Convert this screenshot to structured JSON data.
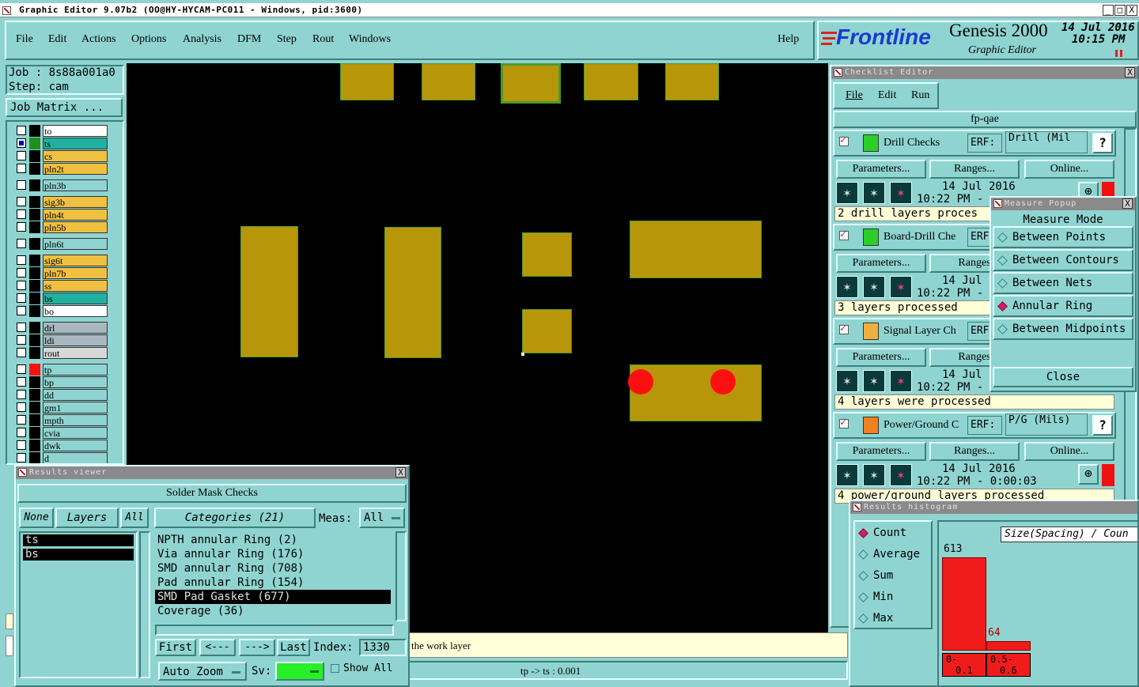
{
  "window": {
    "title": "Graphic Editor 9.07b2  (OO@HY-HYCAM-PC011 - Windows, pid:3600)",
    "controls": [
      "_",
      "□",
      "X"
    ]
  },
  "menu": {
    "items": [
      "File",
      "Edit",
      "Actions",
      "Options",
      "Analysis",
      "DFM",
      "Step",
      "Rout",
      "Windows"
    ],
    "help": "Help"
  },
  "branding": {
    "logo": "Frontline",
    "product": "Genesis 2000",
    "subtitle": "Graphic Editor",
    "date": "14 Jul 2016",
    "time": "10:15 PM"
  },
  "job": {
    "job_label": "Job : 8s88a001a0",
    "step_label": "Step: cam",
    "matrix_button": "Job Matrix ..."
  },
  "layers": [
    {
      "name": "to",
      "color": "#000000",
      "bg": "#ffffff",
      "checked": false
    },
    {
      "name": "ts",
      "color": "#1f8f1f",
      "bg": "#20b0a0",
      "checked": true
    },
    {
      "name": "cs",
      "color": "#000000",
      "bg": "#f0c040",
      "checked": false
    },
    {
      "name": "pln2t",
      "color": "#000000",
      "bg": "#f0c040",
      "checked": false
    },
    {
      "name": "pln3b",
      "color": "#000000",
      "bg": "#8fd4d0",
      "checked": false
    },
    {
      "name": "sig3b",
      "color": "#000000",
      "bg": "#f0c040",
      "checked": false
    },
    {
      "name": "pln4t",
      "color": "#000000",
      "bg": "#f0c040",
      "checked": false
    },
    {
      "name": "pln5b",
      "color": "#000000",
      "bg": "#f0c040",
      "checked": false
    },
    {
      "name": "pln6t",
      "color": "#000000",
      "bg": "#8fd4d0",
      "checked": false
    },
    {
      "name": "sig6t",
      "color": "#000000",
      "bg": "#f0c040",
      "checked": false
    },
    {
      "name": "pln7b",
      "color": "#000000",
      "bg": "#f0c040",
      "checked": false
    },
    {
      "name": "ss",
      "color": "#000000",
      "bg": "#f0c040",
      "checked": false
    },
    {
      "name": "bs",
      "color": "#000000",
      "bg": "#20b0a0",
      "checked": false
    },
    {
      "name": "bo",
      "color": "#000000",
      "bg": "#ffffff",
      "checked": false
    },
    {
      "name": "drl",
      "color": "#000000",
      "bg": "#a8b8c0",
      "checked": false
    },
    {
      "name": "ldi",
      "color": "#000000",
      "bg": "#a8b8c0",
      "checked": false
    },
    {
      "name": "rout",
      "color": "#000000",
      "bg": "#d8d8d8",
      "checked": false
    },
    {
      "name": "tp",
      "color": "#ff1010",
      "bg": "#8fd4d0",
      "checked": false
    },
    {
      "name": "bp",
      "color": "#000000",
      "bg": "#8fd4d0",
      "checked": false
    },
    {
      "name": "dd",
      "color": "#000000",
      "bg": "#8fd4d0",
      "checked": false
    },
    {
      "name": "gm1",
      "color": "#000000",
      "bg": "#8fd4d0",
      "checked": false
    },
    {
      "name": "mpth",
      "color": "#000000",
      "bg": "#8fd4d0",
      "checked": false
    },
    {
      "name": "cvia",
      "color": "#000000",
      "bg": "#8fd4d0",
      "checked": false
    },
    {
      "name": "dwk",
      "color": "#000000",
      "bg": "#8fd4d0",
      "checked": false
    },
    {
      "name": "d",
      "color": "#000000",
      "bg": "#8fd4d0",
      "checked": false
    }
  ],
  "status": {
    "message": "the work layer",
    "measure": "tp -> ts : 0.001"
  },
  "results_viewer": {
    "title": "Results viewer",
    "heading": "Solder Mask Checks",
    "btn_none": "None",
    "btn_layers": "Layers",
    "btn_all": "All",
    "btn_categories": "Categories (21)",
    "meas_label": "Meas:",
    "meas_value": "All",
    "layers": [
      "ts",
      "bs"
    ],
    "categories": [
      "NPTH annular Ring (2)",
      "Via annular Ring (176)",
      "SMD annular Ring (708)",
      "Pad annular Ring (154)",
      "SMD Pad Gasket (677)",
      "Coverage (36)"
    ],
    "selected_index": 4,
    "first": "First",
    "prev": "<---",
    "next": "--->",
    "last": "Last",
    "index_label": "Index:",
    "index_value": "1330",
    "auto_zoom": "Auto Zoom",
    "sv_label": "Sv:",
    "show_all": "Show All"
  },
  "checklist": {
    "title": "Checklist Editor",
    "menu": [
      "File",
      "Edit",
      "Run"
    ],
    "name": "fp-qae",
    "checks": [
      {
        "name": "Drill Checks",
        "erf": "ERF:",
        "erf_value": "Drill (Mil",
        "params": "Parameters...",
        "ranges": "Ranges...",
        "online": "Online...",
        "date": "14 Jul 2016",
        "time": "10:22 PM -",
        "result": "2 drill layers proces"
      },
      {
        "name": "Board-Drill Che",
        "erf": "ERF",
        "erf_value": "",
        "params": "Parameters...",
        "ranges": "Ranges",
        "online": "",
        "date": "14 Jul",
        "time": "10:22 PM -",
        "result": "3 layers processed"
      },
      {
        "name": "Signal Layer Ch",
        "erf": "ERF",
        "erf_value": "",
        "params": "Parameters...",
        "ranges": "Ranges",
        "online": "",
        "date": "14 Jul",
        "time": "10:22 PM -",
        "result": "4 layers were processed"
      },
      {
        "name": "Power/Ground C",
        "erf": "ERF:",
        "erf_value": "P/G (Mils)",
        "params": "Parameters...",
        "ranges": "Ranges...",
        "online": "Online...",
        "date": "14 Jul 2016",
        "time": "10:22 PM - 0:00:03",
        "result": "4 power/ground layers processed"
      }
    ]
  },
  "measure_popup": {
    "title": "Measure Popup",
    "mode_label": "Measure Mode",
    "options": [
      "Between Points",
      "Between Contours",
      "Between Nets",
      "Annular Ring",
      "Between Midpoints"
    ],
    "selected": 3,
    "close": "Close"
  },
  "histogram": {
    "title": "Results histogram",
    "options": [
      "Count",
      "Average",
      "Sum",
      "Min",
      "Max"
    ],
    "selected": 0,
    "axis_label": "Size(Spacing) / Coun",
    "bars": [
      {
        "value": 613,
        "label_top": "0-",
        "label_bottom": "0.1"
      },
      {
        "value": 64,
        "label_top": "0.5-",
        "label_bottom": "0.6"
      }
    ]
  },
  "colors": {
    "panel": "#8fd4d0",
    "canvas": "#000000",
    "copper": "#b8960a",
    "highlight": "#ff1010"
  }
}
